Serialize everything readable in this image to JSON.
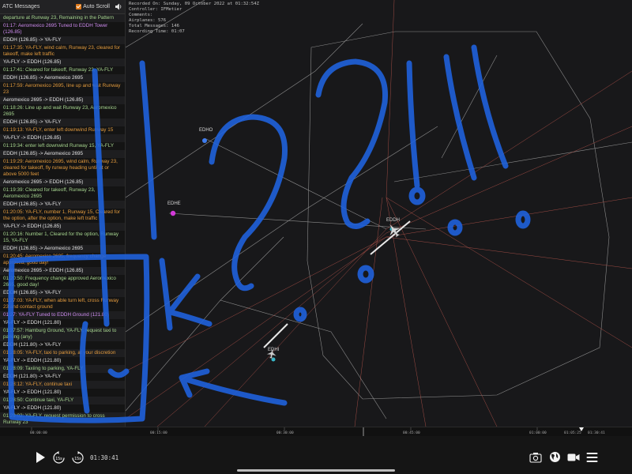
{
  "atc": {
    "title": "ATC Messages",
    "auto_scroll_label": "Auto Scroll",
    "messages": [
      {
        "text": "departure at Runway 23, Remaining in the Pattern",
        "color": "green"
      },
      {
        "text": "01:17: Aeromexico 2695 Tuned to EDDH Tower (126.85)",
        "color": "purple"
      },
      {
        "text": "EDDH (126.85) -> YA-FLY",
        "color": "white"
      },
      {
        "text": "01:17:35: YA-FLY, wind calm, Runway 23, cleared for takeoff, make left traffic",
        "color": "orange"
      },
      {
        "text": "YA-FLY -> EDDH (126.85)",
        "color": "white"
      },
      {
        "text": "01:17:41: Cleared for takeoff, Runway 23, YA-FLY",
        "color": "green"
      },
      {
        "text": "EDDH (126.85) -> Aeromexico 2695",
        "color": "white"
      },
      {
        "text": "01:17:59: Aeromexico 2695, line up and wait Runway 23",
        "color": "orange"
      },
      {
        "text": "Aeromexico 2695 -> EDDH (126.85)",
        "color": "white"
      },
      {
        "text": "01:18:26: Line up and wait Runway 23, Aeromexico 2695",
        "color": "green"
      },
      {
        "text": "EDDH (126.85) -> YA-FLY",
        "color": "white"
      },
      {
        "text": "01:19:13: YA-FLY, enter left downwind Runway 15",
        "color": "orange"
      },
      {
        "text": "YA-FLY -> EDDH (126.85)",
        "color": "white"
      },
      {
        "text": "01:19:34: enter left downwind Runway 15, YA-FLY",
        "color": "green"
      },
      {
        "text": "EDDH (126.85) -> Aeromexico 2695",
        "color": "white"
      },
      {
        "text": "01:19:29: Aeromexico 2695, wind calm, Runway 23, cleared for takeoff, fly runway heading until at or above 5000 feet",
        "color": "orange"
      },
      {
        "text": "Aeromexico 2695 -> EDDH (126.85)",
        "color": "white"
      },
      {
        "text": "01:19:39: Cleared for takeoff, Runway 23, Aeromexico 2695",
        "color": "green"
      },
      {
        "text": "EDDH (126.85) -> YA-FLY",
        "color": "white"
      },
      {
        "text": "01:20:05: YA-FLY, number 1, Runway 15, Cleared for the option, after the option, make left traffic",
        "color": "orange"
      },
      {
        "text": "YA-FLY -> EDDH (126.85)",
        "color": "white"
      },
      {
        "text": "01:20:16: Number 1, Cleared for the option, Runway 15, YA-FLY",
        "color": "green"
      },
      {
        "text": "EDDH (126.85) -> Aeromexico 2695",
        "color": "white"
      },
      {
        "text": "01:20:45: Aeromexico 2695, frequency change approved, good day!",
        "color": "orange"
      },
      {
        "text": "Aeromexico 2695 -> EDDH (126.85)",
        "color": "white"
      },
      {
        "text": "01:20:50: Frequency change approved Aeromexico 2695, good day!",
        "color": "green"
      },
      {
        "text": "EDDH (126.85) -> YA-FLY",
        "color": "white"
      },
      {
        "text": "01:27:03: YA-FLY, when able turn left, cross Runway 23 and contact ground",
        "color": "orange"
      },
      {
        "text": "01:27: YA-FLY Tuned to EDDH Ground (121.80)",
        "color": "purple"
      },
      {
        "text": "YA-FLY -> EDDH (121.80)",
        "color": "white"
      },
      {
        "text": "01:27:57: Hamburg Ground, YA-FLY, request taxi to parking (any)",
        "color": "green"
      },
      {
        "text": "EDDH (121.80) -> YA-FLY",
        "color": "white"
      },
      {
        "text": "01:28:05: YA-FLY, taxi to parking, at your discretion",
        "color": "orange"
      },
      {
        "text": "YA-FLY -> EDDH (121.80)",
        "color": "white"
      },
      {
        "text": "01:28:09: Taxiing to parking, YA-FLY",
        "color": "green"
      },
      {
        "text": "EDDH (121.80) -> YA-FLY",
        "color": "white"
      },
      {
        "text": "01:28:12: YA-FLY, continue taxi",
        "color": "orange"
      },
      {
        "text": "YA-FLY -> EDDH (121.80)",
        "color": "white"
      },
      {
        "text": "01:28:50: Continue taxi, YA-FLY",
        "color": "green"
      },
      {
        "text": "YA-FLY -> EDDH (121.80)",
        "color": "white"
      },
      {
        "text": "01:29:02: YA-FLY, request permission to cross Runway 23",
        "color": "green"
      },
      {
        "text": "EDDH (121.80) -> YA-FLY",
        "color": "white"
      },
      {
        "text": "01:29:21: YA-FLY, you were already instructed to cross the runway",
        "color": "orange"
      },
      {
        "text": "YA-FLY -> EDDH (121.80)",
        "color": "white"
      },
      {
        "text": "01:29:51: Roger, YA-FLY",
        "color": "green"
      }
    ]
  },
  "recording": {
    "recorded_on": "Recorded On: Sunday, 09 October 2022 at 01:32:54Z",
    "controller": "Controller: IFMetier",
    "comments": "Comments:",
    "airplanes": "Airplanes: 576",
    "total_messages": "Total Messages: 146",
    "recording_time": "Recording Time: 01:07"
  },
  "map": {
    "airports": [
      {
        "name": "EDHO",
        "color": "#3f7df0"
      },
      {
        "name": "EDHE",
        "color": "#d23ad8"
      },
      {
        "name": "EDDH",
        "color": "#38b6c8"
      },
      {
        "name": "EDHI",
        "color": "#38b6c8"
      }
    ]
  },
  "timeline": {
    "labels": [
      "00:00:00",
      "00:15:00",
      "00:30:00",
      "00:45:00",
      "01:00:00",
      "01:05:25",
      "01:30:41"
    ]
  },
  "controls": {
    "current_time": "01:30:41",
    "rewind_label": "15s",
    "forward_label": "15s",
    "icons": [
      "play-icon",
      "rewind-15-icon",
      "forward-15-icon",
      "camera-icon",
      "globe-icon",
      "video-icon",
      "menu-icon"
    ]
  },
  "colors": {
    "accent": "#e07a1a",
    "scribble": "#1f63e0"
  }
}
